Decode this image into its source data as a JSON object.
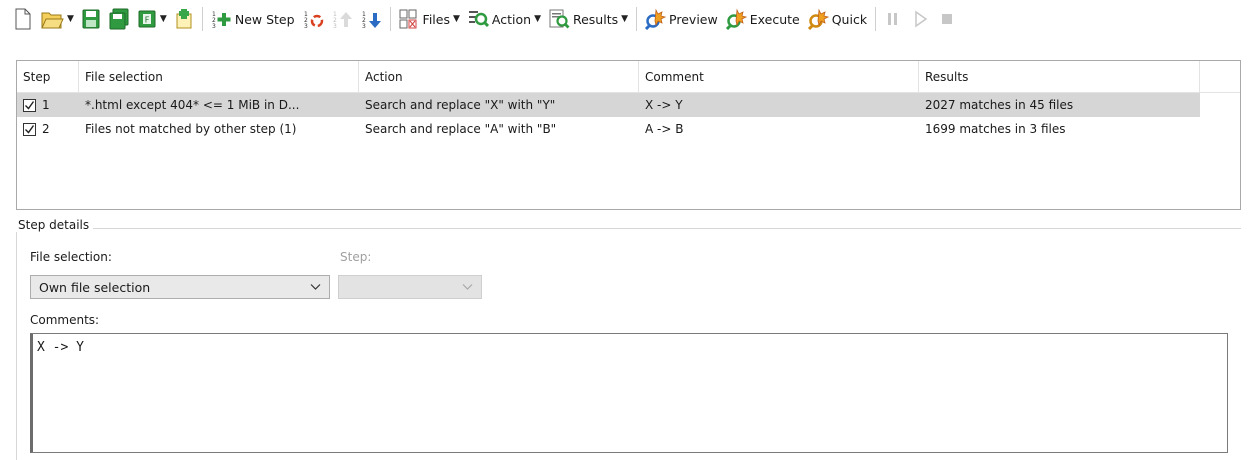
{
  "toolbar": {
    "new_step": "New Step",
    "files": "Files",
    "action": "Action",
    "results": "Results",
    "preview": "Preview",
    "execute": "Execute",
    "quick": "Quick"
  },
  "table": {
    "headers": [
      "Step",
      "File selection",
      "Action",
      "Comment",
      "Results"
    ],
    "rows": [
      {
        "checked": true,
        "step": "1",
        "file_selection": "*.html except 404* <= 1 MiB in D...",
        "action": "Search and replace \"X\" with \"Y\"",
        "comment": "X -> Y",
        "results": "2027 matches in 45 files",
        "selected": true
      },
      {
        "checked": true,
        "step": "2",
        "file_selection": "Files not matched by other step (1)",
        "action": "Search and replace \"A\" with \"B\"",
        "comment": "A -> B",
        "results": "1699 matches in 3 files",
        "selected": false
      }
    ]
  },
  "details": {
    "legend": "Step details",
    "file_selection_label": "File selection:",
    "file_selection_value": "Own file selection",
    "step_label": "Step:",
    "step_value": "",
    "comments_label": "Comments:",
    "comments_value": "X -> Y"
  },
  "colors": {
    "selected_row": "#d6d6d6",
    "accent_green": "#2e9e3e",
    "accent_yellow": "#f2c230",
    "accent_orange": "#e0661c"
  }
}
